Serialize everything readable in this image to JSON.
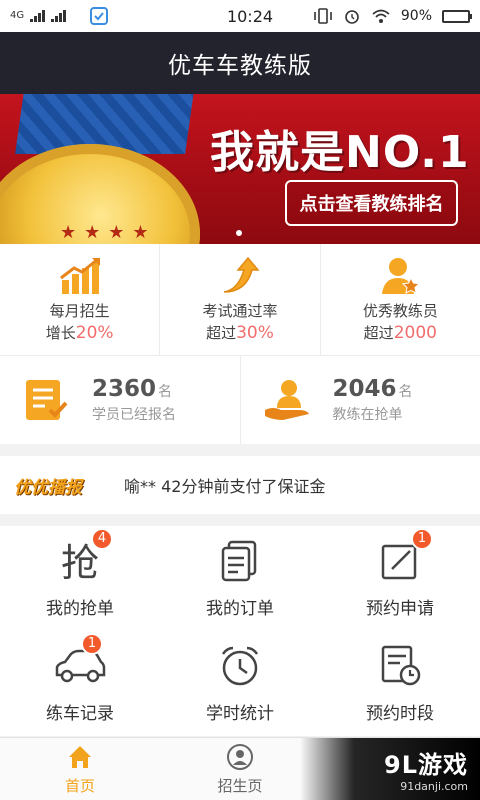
{
  "status_bar": {
    "network": "4G",
    "time": "10:24",
    "battery_percent": "90%",
    "battery_level": 0.9
  },
  "header": {
    "title": "优车车教练版"
  },
  "banner": {
    "headline": "我就是NO.1",
    "cta": "点击查看教练排名"
  },
  "stats": [
    {
      "line1": "每月招生",
      "prefix": "增长",
      "value": "20%"
    },
    {
      "line1": "考试通过率",
      "prefix": "超过",
      "value": "30%"
    },
    {
      "line1": "优秀教练员",
      "prefix": "超过",
      "value": "2000"
    }
  ],
  "counters": [
    {
      "number": "2360",
      "unit": "名",
      "desc": "学员已经报名"
    },
    {
      "number": "2046",
      "unit": "名",
      "desc": "教练在抢单"
    }
  ],
  "broadcast": {
    "logo": "优优播报",
    "message": "喻** 42分钟前支付了保证金"
  },
  "menu": [
    {
      "label": "我的抢单",
      "icon": "grab-order-icon",
      "badge": "4"
    },
    {
      "label": "我的订单",
      "icon": "orders-icon",
      "badge": ""
    },
    {
      "label": "预约申请",
      "icon": "appointment-request-icon",
      "badge": "1"
    },
    {
      "label": "练车记录",
      "icon": "car-icon",
      "badge": "1"
    },
    {
      "label": "学时统计",
      "icon": "alarm-clock-icon",
      "badge": ""
    },
    {
      "label": "预约时段",
      "icon": "schedule-icon",
      "badge": ""
    }
  ],
  "bottom_nav": [
    {
      "label": "首页",
      "icon": "home-icon",
      "active": true
    },
    {
      "label": "招生页",
      "icon": "person-icon",
      "active": false
    }
  ],
  "watermark": {
    "brand": "9L游戏",
    "url": "91danji.com"
  },
  "colors": {
    "accent": "#f3a21b",
    "highlight": "#f26d6d",
    "badge": "#f35a2b",
    "header_bg": "#23232d"
  }
}
